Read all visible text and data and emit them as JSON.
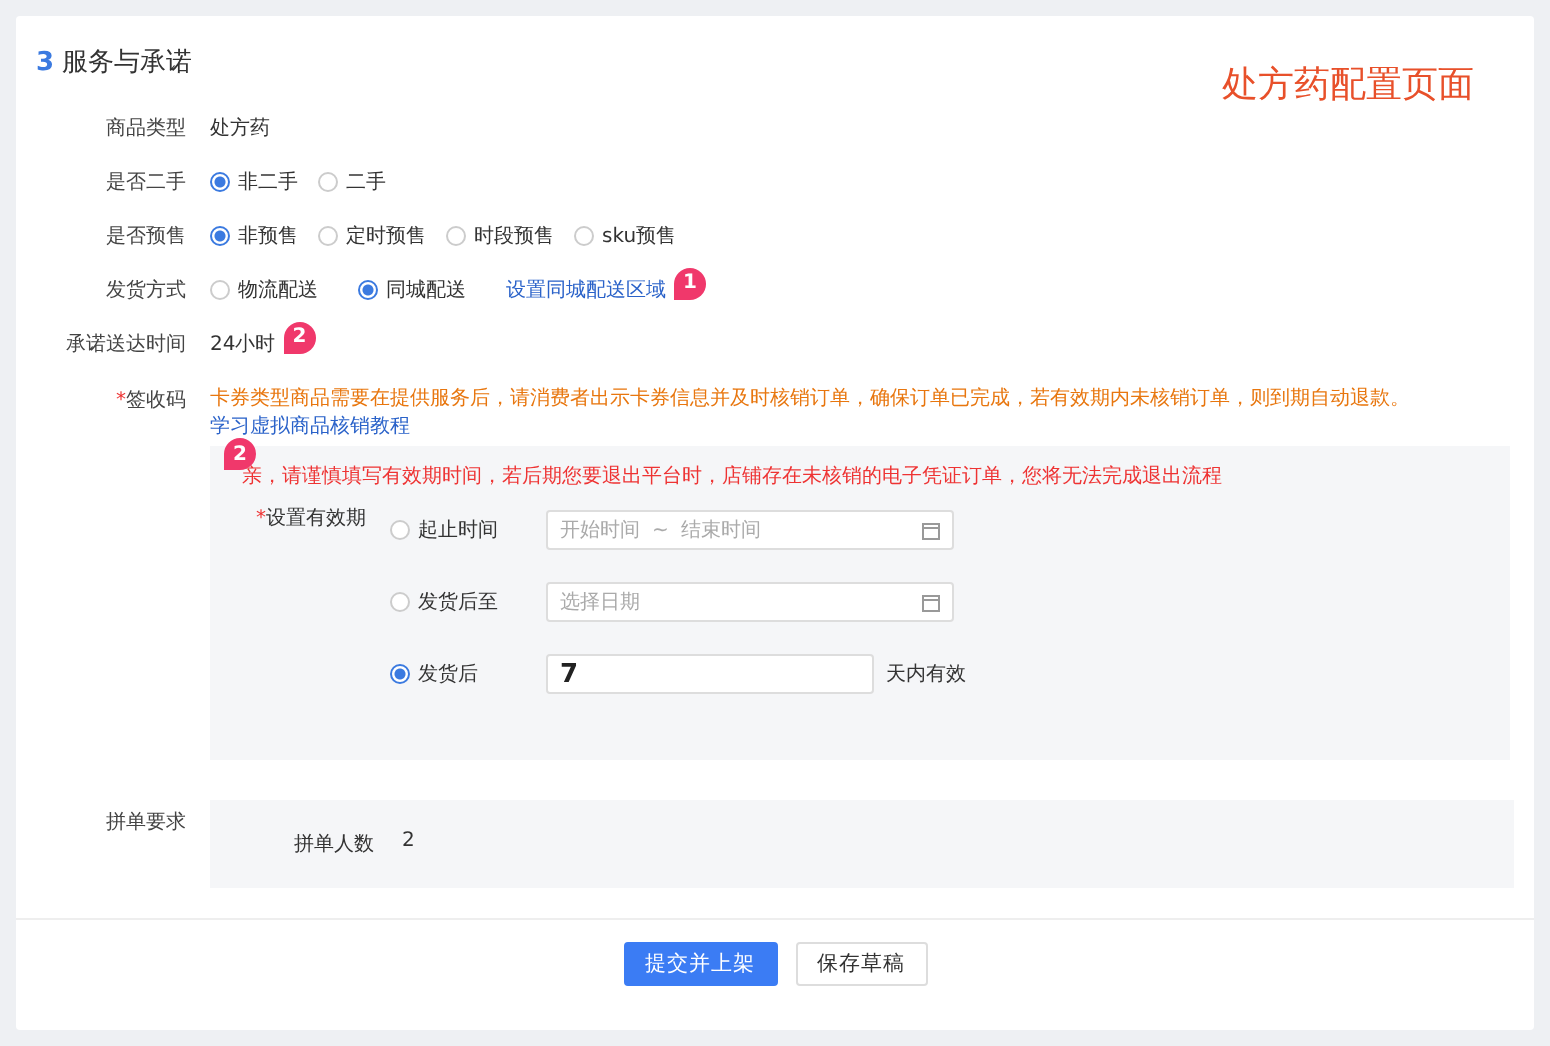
{
  "section": {
    "number": "3",
    "title": "服务与承诺"
  },
  "annotation": "处方药配置页面",
  "fields": [
    {
      "kind": "text",
      "label": "商品类型",
      "value": "处方药"
    },
    {
      "kind": "radio",
      "label": "是否二手",
      "options": [
        {
          "label": "非二手",
          "selected": true
        },
        {
          "label": "二手",
          "selected": false
        }
      ]
    },
    {
      "kind": "radio",
      "label": "是否预售",
      "options": [
        {
          "label": "非预售",
          "selected": true
        },
        {
          "label": "定时预售",
          "selected": false
        },
        {
          "label": "时段预售",
          "selected": false
        },
        {
          "label": "sku预售",
          "selected": false
        }
      ]
    },
    {
      "kind": "radio",
      "label": "发货方式",
      "options": [
        {
          "label": "物流配送",
          "selected": false
        },
        {
          "label": "同城配送",
          "selected": true
        }
      ],
      "link": "设置同城配送区域",
      "badge": "1"
    },
    {
      "kind": "text",
      "label": "承诺送达时间",
      "value": "24小时",
      "badge": "2"
    }
  ],
  "signature": {
    "label": "签收码",
    "required_mark": "*",
    "notice": "卡券类型商品需要在提供服务后，请消费者出示卡券信息并及时核销订单，确保订单已完成，若有效期内未核销订单，则到期自动退款。",
    "link": "学习虚拟商品核销教程",
    "badge": "2",
    "warning": "亲，请谨慎填写有效期时间，若后期您要退出平台时，店铺存在未核销的电子凭证订单，您将无法完成退出流程",
    "validity": {
      "label": "设置有效期",
      "required_mark": "*",
      "options": [
        {
          "kind": "range",
          "label": "起止时间",
          "selected": false,
          "start_placeholder": "开始时间",
          "separator": "~",
          "end_placeholder": "结束时间"
        },
        {
          "kind": "date",
          "label": "发货后至",
          "selected": false,
          "placeholder": "选择日期"
        },
        {
          "kind": "number",
          "label": "发货后",
          "selected": true,
          "value": "7",
          "suffix": "天内有效"
        }
      ]
    }
  },
  "group_buy": {
    "label": "拼单要求",
    "items": [
      {
        "label": "拼单人数",
        "value": "2"
      }
    ]
  },
  "buttons": [
    {
      "label": "提交并上架",
      "kind": "primary"
    },
    {
      "label": "保存草稿",
      "kind": "default"
    }
  ]
}
